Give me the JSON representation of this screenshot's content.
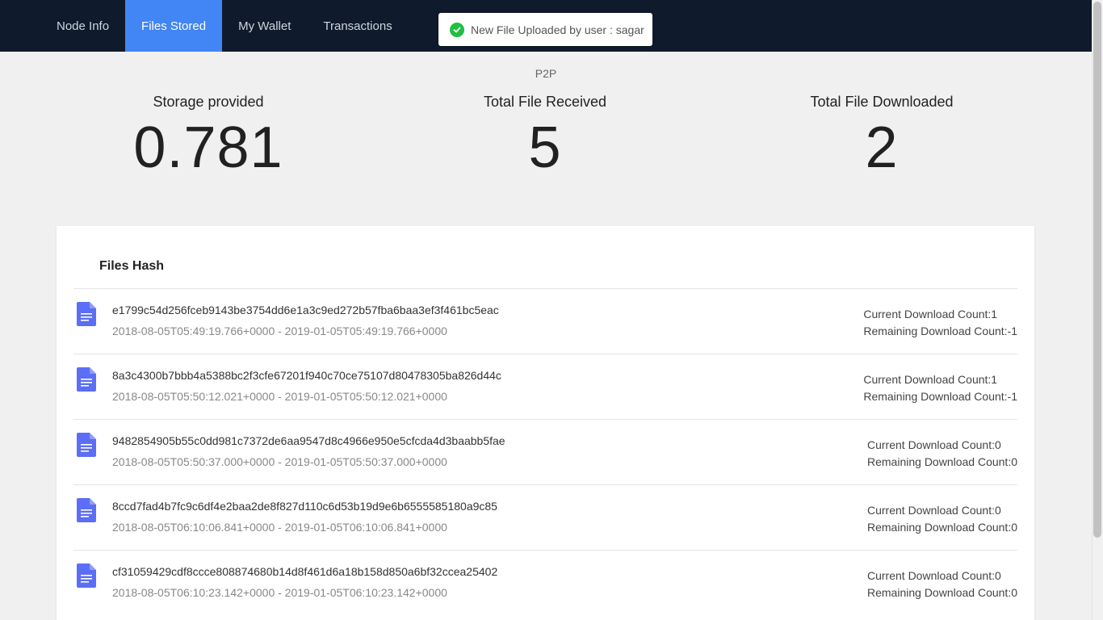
{
  "nav": {
    "tabs": [
      {
        "label": "Node Info"
      },
      {
        "label": "Files Stored"
      },
      {
        "label": "My Wallet"
      },
      {
        "label": "Transactions"
      }
    ]
  },
  "toast": {
    "message": "New File Uploaded by user : sagar",
    "icon": "check-circle-icon",
    "color": "#1fbf3f"
  },
  "page": {
    "subtitle": "P2P"
  },
  "stats": [
    {
      "label": "Storage provided",
      "value": "0.781"
    },
    {
      "label": "Total File Received",
      "value": "5"
    },
    {
      "label": "Total File Downloaded",
      "value": "2"
    }
  ],
  "files": {
    "title": "Files Hash",
    "items": [
      {
        "hash": "e1799c54d256fceb9143be3754dd6e1a3c9ed272b57fba6baa3ef3f461bc5eac",
        "dates": "2018-08-05T05:49:19.766+0000 - 2019-01-05T05:49:19.766+0000",
        "current": "Current Download Count:1",
        "remaining": "Remaining Download Count:-1"
      },
      {
        "hash": "8a3c4300b7bbb4a5388bc2f3cfe67201f940c70ce75107d80478305ba826d44c",
        "dates": "2018-08-05T05:50:12.021+0000 - 2019-01-05T05:50:12.021+0000",
        "current": "Current Download Count:1",
        "remaining": "Remaining Download Count:-1"
      },
      {
        "hash": "9482854905b55c0dd981c7372de6aa9547d8c4966e950e5cfcda4d3baabb5fae",
        "dates": "2018-08-05T05:50:37.000+0000 - 2019-01-05T05:50:37.000+0000",
        "current": "Current Download Count:0",
        "remaining": "Remaining Download Count:0"
      },
      {
        "hash": "8ccd7fad4b7fc9c6df4e2baa2de8f827d110c6d53b19d9e6b6555585180a9c85",
        "dates": "2018-08-05T06:10:06.841+0000 - 2019-01-05T06:10:06.841+0000",
        "current": "Current Download Count:0",
        "remaining": "Remaining Download Count:0"
      },
      {
        "hash": "cf31059429cdf8ccce808874680b14d8f461d6a18b158d850a6bf32ccea25402",
        "dates": "2018-08-05T06:10:23.142+0000 - 2019-01-05T06:10:23.142+0000",
        "current": "Current Download Count:0",
        "remaining": "Remaining Download Count:0"
      }
    ]
  },
  "colors": {
    "navbar": "#0f1b2c",
    "active_tab": "#4285f4",
    "file_icon": "#5b6ef5"
  }
}
